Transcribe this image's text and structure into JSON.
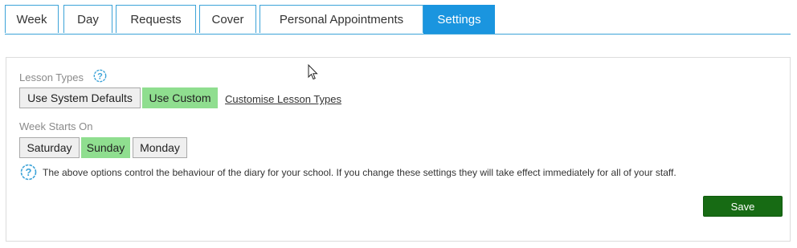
{
  "tabs": [
    {
      "label": "Week"
    },
    {
      "label": "Day"
    },
    {
      "label": "Requests"
    },
    {
      "label": "Cover"
    },
    {
      "label": "Personal Appointments"
    },
    {
      "label": "Settings",
      "active": true
    }
  ],
  "settings": {
    "lesson_types": {
      "label": "Lesson Types",
      "options": [
        "Use System Defaults",
        "Use Custom"
      ],
      "selected": "Use Custom",
      "customise_link": "Customise Lesson Types"
    },
    "week_starts_on": {
      "label": "Week Starts On",
      "options": [
        "Saturday",
        "Sunday",
        "Monday"
      ],
      "selected": "Sunday"
    },
    "info_text": "The above options control the behaviour of the diary for your school. If you change these settings they will take effect immediately for all of your staff.",
    "save_label": "Save"
  },
  "colors": {
    "tab_active": "#1a95df",
    "tab_border": "#3ca3d8",
    "selected_option": "#8fde8f",
    "save_button": "#176b14",
    "help_icon": "#3ca3d8"
  },
  "icons": {
    "help": "help-circle-icon",
    "cursor": "mouse-pointer-icon"
  }
}
